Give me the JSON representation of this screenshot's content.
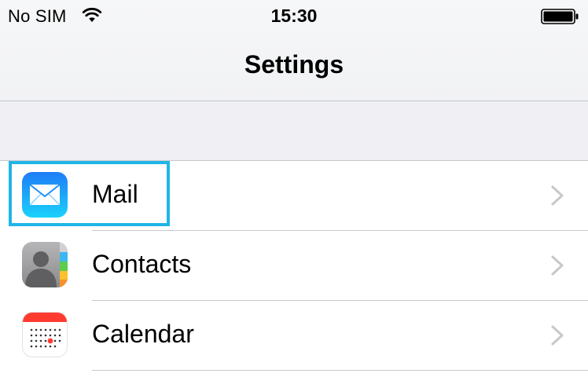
{
  "status_bar": {
    "carrier": "No SIM",
    "time": "15:30",
    "wifi_icon": "wifi-icon",
    "battery_icon": "battery-full-icon"
  },
  "nav": {
    "title": "Settings"
  },
  "settings_items": [
    {
      "label": "Mail",
      "icon": "mail-icon"
    },
    {
      "label": "Contacts",
      "icon": "contacts-icon"
    },
    {
      "label": "Calendar",
      "icon": "calendar-icon"
    }
  ],
  "colors": {
    "highlight": "#1fb6e8",
    "group_background": "#efeff4",
    "separator": "#c8c7cc",
    "chevron": "#c7c7cc",
    "calendar_accent": "#ff3b30"
  }
}
